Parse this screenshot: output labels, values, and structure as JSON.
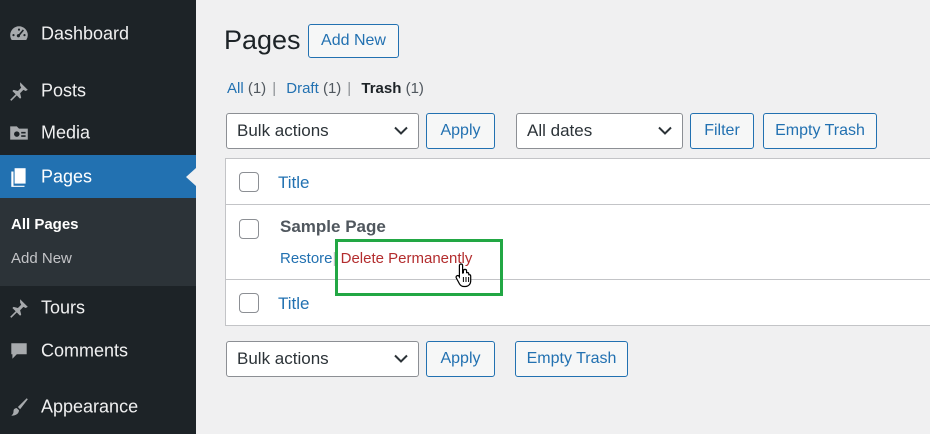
{
  "sidebar": {
    "items": [
      {
        "label": "Dashboard",
        "icon": "dashboard-icon"
      },
      {
        "label": "Posts",
        "icon": "pushpin-icon"
      },
      {
        "label": "Media",
        "icon": "media-icon"
      },
      {
        "label": "Pages",
        "icon": "pages-icon",
        "current": true
      },
      {
        "label": "Tours",
        "icon": "pushpin-icon"
      },
      {
        "label": "Comments",
        "icon": "comments-icon"
      },
      {
        "label": "Appearance",
        "icon": "brush-icon"
      }
    ],
    "submenu": [
      {
        "label": "All Pages",
        "current": true
      },
      {
        "label": "Add New"
      }
    ]
  },
  "header": {
    "title": "Pages",
    "add_new_label": "Add New"
  },
  "views": [
    {
      "label": "All",
      "count": "(1)"
    },
    {
      "label": "Draft",
      "count": "(1)"
    },
    {
      "label": "Trash",
      "count": "(1)",
      "current": true
    }
  ],
  "top_nav": {
    "bulk_actions": "Bulk actions",
    "apply_label": "Apply",
    "dates": "All dates",
    "filter_label": "Filter",
    "empty_trash_label": "Empty Trash"
  },
  "table": {
    "header_title": "Title",
    "footer_title": "Title",
    "rows": [
      {
        "title": "Sample Page",
        "actions": {
          "restore": "Restore",
          "separator": "|",
          "delete": "Delete Permanently"
        }
      }
    ]
  },
  "bottom_nav": {
    "bulk_actions": "Bulk actions",
    "apply_label": "Apply",
    "empty_trash_label": "Empty Trash"
  },
  "colors": {
    "sidebar_bg": "#1d2327",
    "submenu_bg": "#2c3338",
    "accent": "#2271b1",
    "delete": "#b32d2e",
    "highlight": "#22a744"
  }
}
